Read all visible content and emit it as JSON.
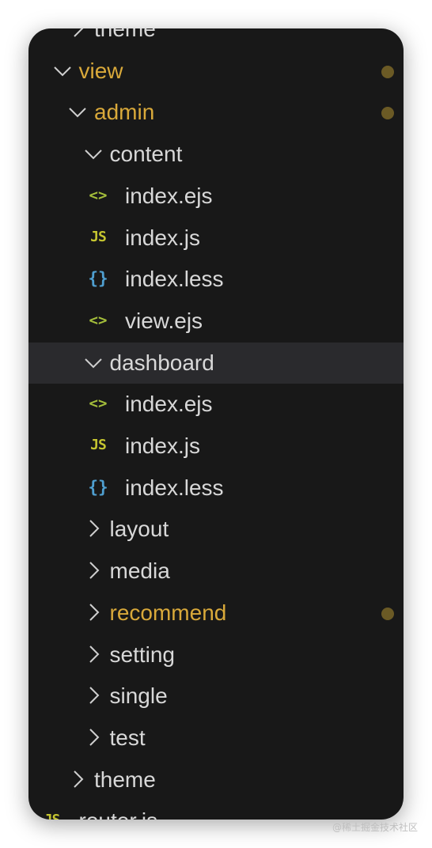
{
  "explorer": {
    "rows": [
      {
        "label": "theme",
        "type": "folder",
        "expanded": false,
        "depth": 2,
        "modified": false
      },
      {
        "label": "view",
        "type": "folder",
        "expanded": true,
        "depth": 1,
        "modified": true
      },
      {
        "label": "admin",
        "type": "folder",
        "expanded": true,
        "depth": 2,
        "modified": true
      },
      {
        "label": "content",
        "type": "folder",
        "expanded": true,
        "depth": 3,
        "modified": false
      },
      {
        "label": "index.ejs",
        "type": "file",
        "icon": "ejs",
        "icon_text": "<>",
        "depth": 4
      },
      {
        "label": "index.js",
        "type": "file",
        "icon": "js",
        "icon_text": "JS",
        "depth": 4
      },
      {
        "label": "index.less",
        "type": "file",
        "icon": "less",
        "icon_text": "{}",
        "depth": 4
      },
      {
        "label": "view.ejs",
        "type": "file",
        "icon": "ejs",
        "icon_text": "<>",
        "depth": 4
      },
      {
        "label": "dashboard",
        "type": "folder",
        "expanded": true,
        "depth": 3,
        "modified": false,
        "selected": true
      },
      {
        "label": "index.ejs",
        "type": "file",
        "icon": "ejs",
        "icon_text": "<>",
        "depth": 4
      },
      {
        "label": "index.js",
        "type": "file",
        "icon": "js",
        "icon_text": "JS",
        "depth": 4
      },
      {
        "label": "index.less",
        "type": "file",
        "icon": "less",
        "icon_text": "{}",
        "depth": 4
      },
      {
        "label": "layout",
        "type": "folder",
        "expanded": false,
        "depth": 3,
        "modified": false
      },
      {
        "label": "media",
        "type": "folder",
        "expanded": false,
        "depth": 3,
        "modified": false
      },
      {
        "label": "recommend",
        "type": "folder",
        "expanded": false,
        "depth": 3,
        "modified": true
      },
      {
        "label": "setting",
        "type": "folder",
        "expanded": false,
        "depth": 3,
        "modified": false
      },
      {
        "label": "single",
        "type": "folder",
        "expanded": false,
        "depth": 3,
        "modified": false
      },
      {
        "label": "test",
        "type": "folder",
        "expanded": false,
        "depth": 3,
        "modified": false
      },
      {
        "label": "theme",
        "type": "folder",
        "expanded": false,
        "depth": 2,
        "modified": false
      },
      {
        "label": "router.js",
        "type": "file",
        "icon": "js",
        "icon_text": "JS",
        "depth": 1
      }
    ]
  },
  "colors": {
    "panel_bg": "#181818",
    "selected_bg": "#2a2a2d",
    "modified_text": "#d9a93a",
    "modified_dot": "#6b5a25",
    "ejs_icon": "#a5bf3b",
    "js_icon": "#c5c530",
    "less_icon": "#4f9fd0"
  },
  "watermark": "@稀土掘金技术社区"
}
